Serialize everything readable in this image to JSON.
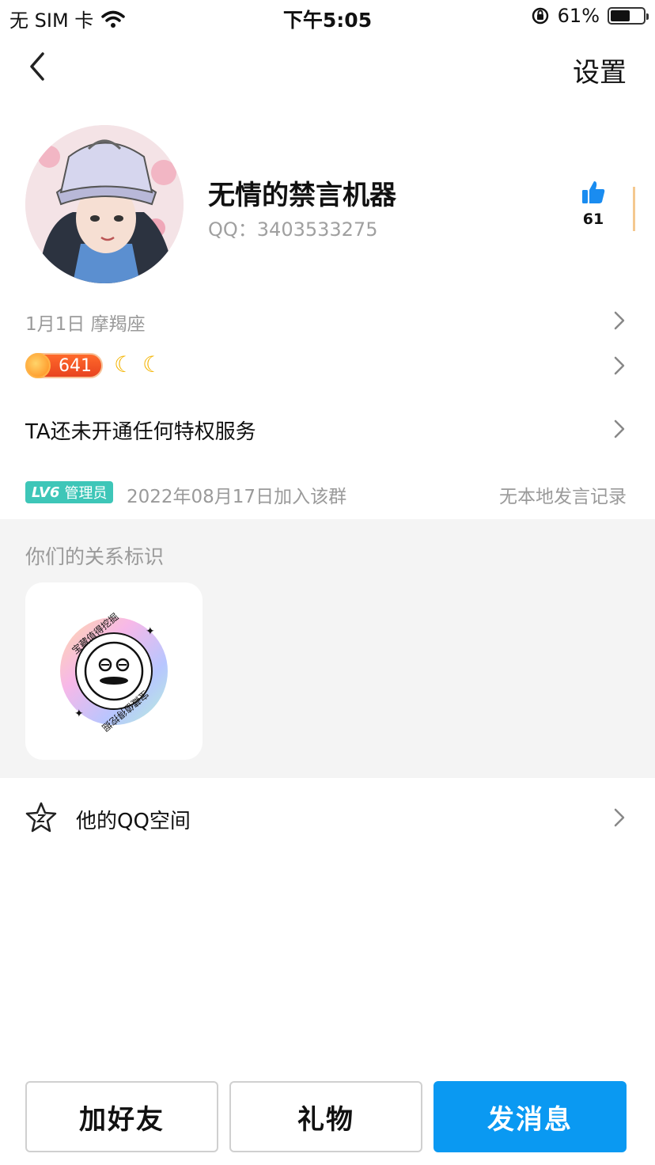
{
  "status_bar": {
    "carrier": "无 SIM 卡",
    "time": "下午5:05",
    "battery": "61%",
    "battery_level": 0.61
  },
  "nav": {
    "settings_label": "设置"
  },
  "profile": {
    "name": "无情的禁言机器",
    "qq": "QQ：3403533275",
    "likes": "61"
  },
  "info": {
    "birthday": "1月1日 摩羯座",
    "level_value": "641",
    "privilege": "TA还未开通任何特权服务"
  },
  "group": {
    "level_tag": "LV6",
    "role": "管理员",
    "join_text": "2022年08月17日加入该群",
    "speak_record": "无本地发言记录"
  },
  "relation": {
    "title": "你们的关系标识",
    "badge_text": "宝藏值得挖掘"
  },
  "qzone": {
    "label": "他的QQ空间"
  },
  "actions": {
    "add_friend": "加好友",
    "gift": "礼物",
    "send_message": "发消息"
  },
  "colors": {
    "primary": "#0a99f2",
    "admin_tag": "#3ec6b8",
    "level_badge": "#e8431f"
  }
}
